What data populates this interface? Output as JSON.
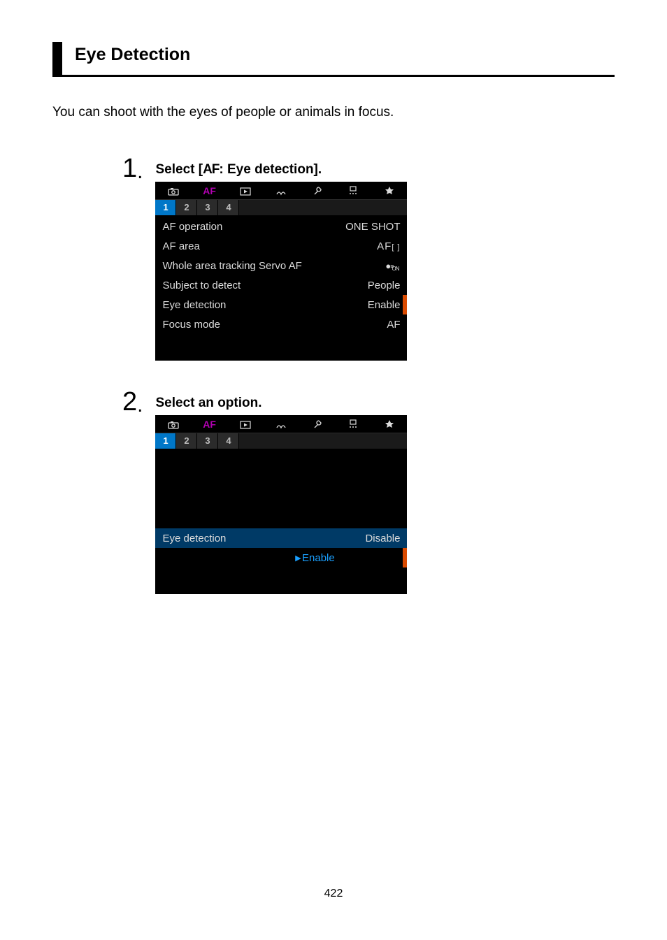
{
  "page_title": "Eye Detection",
  "intro": "You can shoot with the eyes of people or animals in focus.",
  "steps": [
    {
      "num": "1",
      "title_prefix": "Select [",
      "title_glyph": "AF",
      "title_suffix": ": Eye detection]."
    },
    {
      "num": "2",
      "title": "Select an option."
    }
  ],
  "screen1": {
    "top_tabs": [
      "camera",
      "AF",
      "play",
      "net",
      "wrench",
      "dots",
      "star"
    ],
    "sub_tabs": [
      "1",
      "2",
      "3",
      "4"
    ],
    "rows": [
      {
        "label": "AF operation",
        "value": "ONE SHOT"
      },
      {
        "label": "AF area",
        "value": "AF[ ]"
      },
      {
        "label": "Whole area tracking Servo AF",
        "value": "",
        "servo": true
      },
      {
        "label": "Subject to detect",
        "value": "People"
      },
      {
        "label": "Eye detection",
        "value": "Enable",
        "highlight": true
      },
      {
        "label": "Focus mode",
        "value": "AF"
      }
    ]
  },
  "screen2": {
    "top_tabs": [
      "camera",
      "AF",
      "play",
      "net",
      "wrench",
      "dots",
      "star"
    ],
    "sub_tabs": [
      "1",
      "2",
      "3",
      "4"
    ],
    "label": "Eye detection",
    "options": [
      "Disable",
      "Enable"
    ],
    "selected": "Enable"
  },
  "page_number": "422"
}
